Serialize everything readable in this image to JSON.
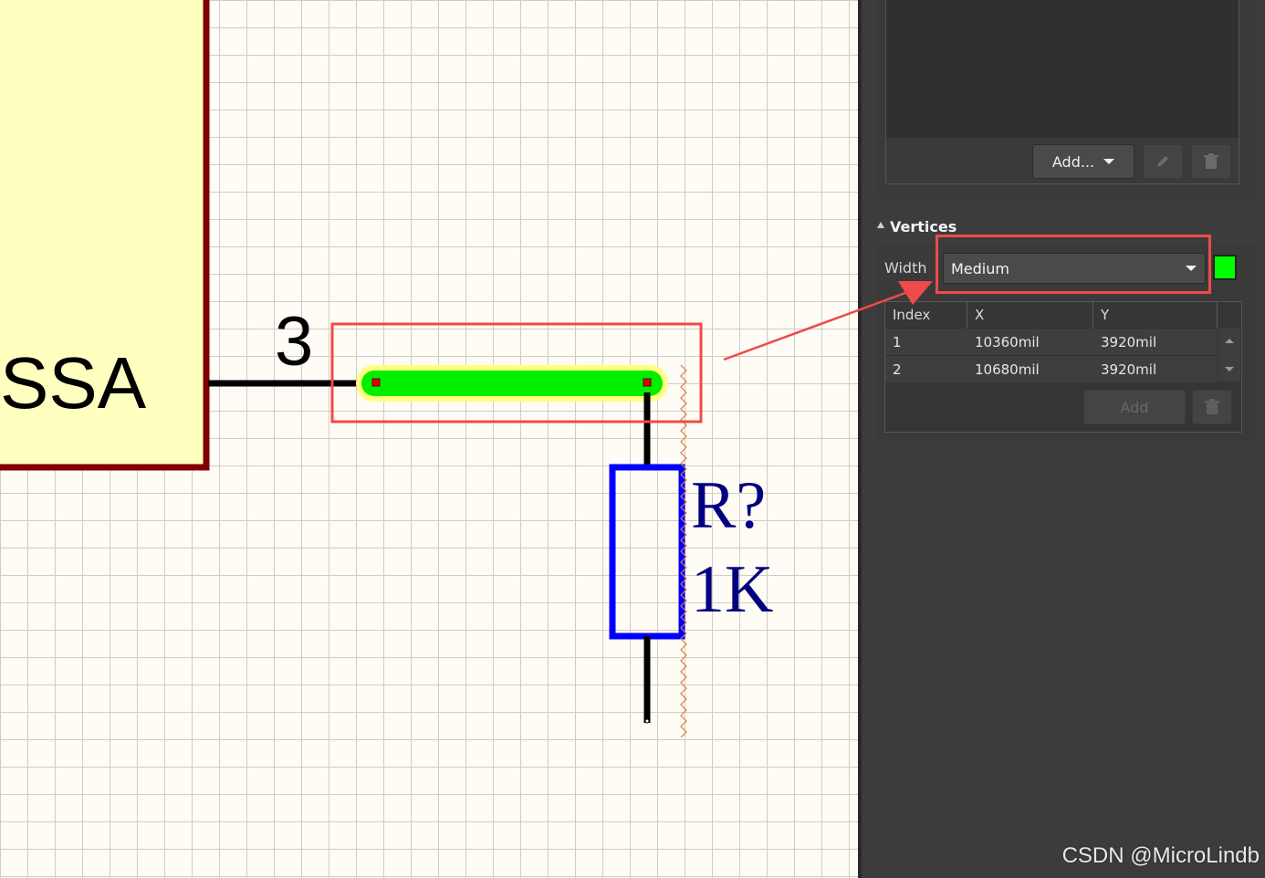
{
  "schematic": {
    "component_label": "SSA",
    "pin_number": "3",
    "resistor": {
      "designator": "R?",
      "value": "1K"
    },
    "colors": {
      "body_fill": "#ffffc0",
      "body_border": "#800000",
      "wire": "#000000",
      "selected_wire": "#00ff00",
      "selection_glow": "#ffff80",
      "resistor": "#0000ff",
      "designator": "#000080",
      "highlight": "#f04a4a"
    }
  },
  "panel": {
    "add_menu_label": "Add...",
    "edit_icon": "pencil-icon",
    "delete_icon": "trash-icon",
    "vertices": {
      "title": "Vertices",
      "width_label": "Width",
      "width_value": "Medium",
      "color_swatch": "#00ff00",
      "columns": [
        "Index",
        "X",
        "Y"
      ],
      "rows": [
        {
          "index": "1",
          "x": "10360mil",
          "y": "3920mil"
        },
        {
          "index": "2",
          "x": "10680mil",
          "y": "3920mil"
        }
      ],
      "add_label": "Add"
    }
  },
  "watermark": "CSDN @MicroLindb"
}
